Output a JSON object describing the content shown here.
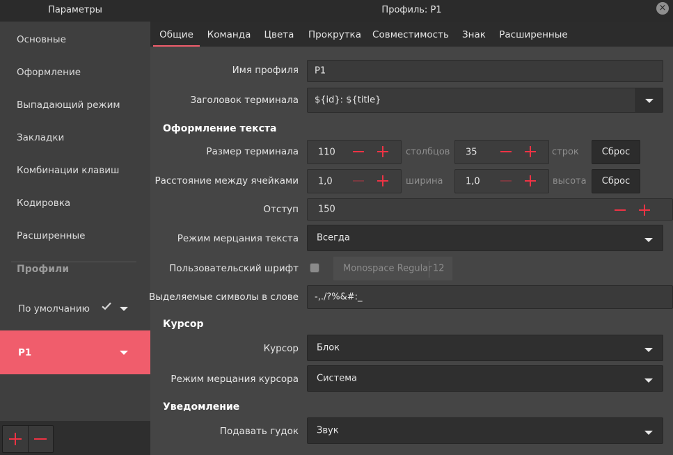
{
  "window": {
    "left_title": "Параметры",
    "main_title": "Профиль: P1",
    "close_glyph": "×"
  },
  "sidebar": {
    "items": [
      {
        "label": "Основные"
      },
      {
        "label": "Оформление"
      },
      {
        "label": "Выпадающий режим"
      },
      {
        "label": "Закладки"
      },
      {
        "label": "Комбинации клавиш"
      },
      {
        "label": "Кодировка"
      },
      {
        "label": "Расширенные"
      }
    ],
    "profiles_heading": "Профили",
    "profiles": [
      {
        "label": "По умолчанию",
        "is_default": true
      },
      {
        "label": "P1",
        "selected": true
      }
    ]
  },
  "tabs": [
    {
      "label": "Общие",
      "active": true
    },
    {
      "label": "Команда"
    },
    {
      "label": "Цвета"
    },
    {
      "label": "Прокрутка"
    },
    {
      "label": "Совместимость"
    },
    {
      "label": "Знак"
    },
    {
      "label": "Расширенные"
    }
  ],
  "form": {
    "profile_name": {
      "label": "Имя профиля",
      "value": "P1"
    },
    "terminal_title": {
      "label": "Заголовок терминала",
      "value": "${id}: ${title}"
    },
    "text_section": "Оформление текста",
    "terminal_size": {
      "label": "Размер терминала",
      "columns": "110",
      "columns_unit": "столбцов",
      "rows": "35",
      "rows_unit": "строк",
      "reset": "Сброс"
    },
    "cell_spacing": {
      "label": "Расстояние между ячейками",
      "width": "1,0",
      "width_unit": "ширина",
      "height": "1,0",
      "height_unit": "высота",
      "reset": "Сброс"
    },
    "padding": {
      "label": "Отступ",
      "value": "150"
    },
    "text_blink": {
      "label": "Режим мерцания текста",
      "value": "Всегда"
    },
    "custom_font": {
      "label": "Пользовательский шрифт",
      "checked": false,
      "font_name": "Monospace Regular",
      "font_size": "12"
    },
    "word_chars": {
      "label": "Выделяемые символы в слове",
      "value": "-,./?%&#:_"
    },
    "cursor_section": "Курсор",
    "cursor": {
      "label": "Курсор",
      "value": "Блок"
    },
    "cursor_blink": {
      "label": "Режим мерцания курсора",
      "value": "Система"
    },
    "notify_section": "Уведомление",
    "bell": {
      "label": "Подавать гудок",
      "value": "Звук"
    }
  },
  "colors": {
    "accent": "#f05d6c",
    "plus_minus_active": "#ee3344",
    "plus_minus_disabled": "#7a3a40"
  }
}
